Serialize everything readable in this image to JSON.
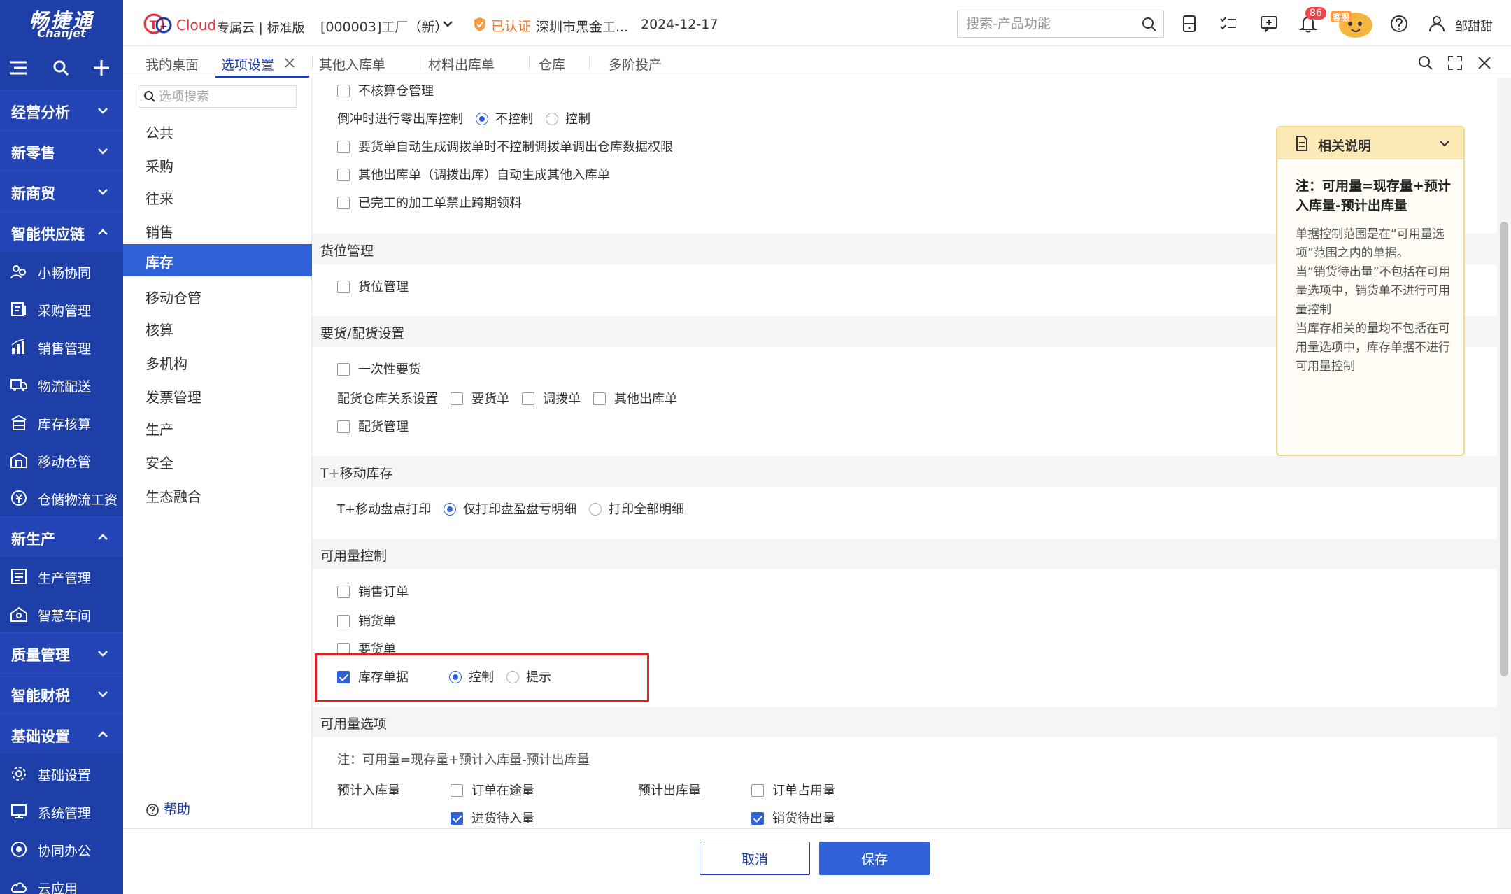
{
  "brand": {
    "name": "畅捷通",
    "sub": "Chanjet"
  },
  "header": {
    "cloud": "Cloud",
    "edition": "专属云 | 标准版",
    "company": "[000003]工厂（新）",
    "cert": "已认证",
    "cert_company": "深圳市黑金工...",
    "date": "2024-12-17",
    "search_placeholder": "搜索-产品功能",
    "badge": "86",
    "mascot_label": "客服",
    "user": "邹甜甜"
  },
  "tabs": [
    {
      "label": "我的桌面"
    },
    {
      "label": "选项设置"
    },
    {
      "label": "其他入库单"
    },
    {
      "label": "材料出库单"
    },
    {
      "label": "仓库"
    },
    {
      "label": "多阶投产"
    }
  ],
  "nav": {
    "groups": {
      "jingying": "经营分析",
      "xinlingshou": "新零售",
      "xinshangmao": "新商贸",
      "gongyinglian": "智能供应链",
      "xinshengchan": "新生产",
      "zhiliang": "质量管理",
      "caishui": "智能财税",
      "jichu": "基础设置"
    },
    "items": {
      "xiaochang": "小畅协同",
      "caigou": "采购管理",
      "xiaoshou": "销售管理",
      "wuliu": "物流配送",
      "kucun": "库存核算",
      "yidong": "移动仓管",
      "cangchu": "仓储物流工资",
      "shengchan": "生产管理",
      "chejian": "智慧车间",
      "jichushezhi": "基础设置",
      "xitong": "系统管理",
      "xietong": "协同办公",
      "yunyingyong": "云应用"
    }
  },
  "categories": {
    "search_placeholder": "选项搜索",
    "items": [
      "公共",
      "采购",
      "往来",
      "销售",
      "库存",
      "移动仓管",
      "核算",
      "多机构",
      "发票管理",
      "生产",
      "安全",
      "生态融合"
    ],
    "help": "帮助"
  },
  "main": {
    "opt_nohesuan": "不核算仓管理",
    "chongjian_label": "倒冲时进行零出库控制",
    "chongjian_opt1": "不控制",
    "chongjian_opt2": "控制",
    "opt_yaohuo": "要货单自动生成调拨单时不控制调拨单调出仓库数据权限",
    "opt_qita": "其他出库单（调拨出库）自动生成其他入库单",
    "opt_jiagong": "已完工的加工单禁止跨期领料",
    "sec_huowei": "货位管理",
    "opt_huowei": "货位管理",
    "sec_yaohuo": "要货/配货设置",
    "opt_yicixing": "一次性要货",
    "peihuo_label": "配货仓库关系设置",
    "peihuo_opt1": "要货单",
    "peihuo_opt2": "调拨单",
    "peihuo_opt3": "其他出库单",
    "opt_peihuo": "配货管理",
    "sec_mobile": "T+移动库存",
    "mobile_label": "T+移动盘点打印",
    "mobile_opt1": "仅打印盘盈盘亏明细",
    "mobile_opt2": "打印全部明细",
    "sec_keyong": "可用量控制",
    "opt_xsdd": "销售订单",
    "opt_xsd": "销货单",
    "opt_yhd": "要货单",
    "opt_kcdj": "库存单据",
    "kcdj_opt1": "控制",
    "kcdj_opt2": "提示",
    "sec_xuanxiang": "可用量选项",
    "note": "注：可用量=现存量+预计入库量-预计出库量",
    "yjrk_label": "预计入库量",
    "yjrk_opt1": "订单在途量",
    "yjrk_opt2": "进货待入量",
    "yjck_label": "预计出库量",
    "yjck_opt1": "订单占用量",
    "yjck_opt2": "销货待出量"
  },
  "card": {
    "head": "相关说明",
    "title": "注：可用量=现存量+预计入库量-预计出库量",
    "body1": "单据控制范围是在“可用量选项”范围之内的单据。",
    "body2": "当“销货待出量”不包括在可用量选项中，销货单不进行可用量控制",
    "body3": "当库存相关的量均不包括在可用量选项中，库存单据不进行可用量控制"
  },
  "footer": {
    "cancel": "取消",
    "save": "保存"
  }
}
